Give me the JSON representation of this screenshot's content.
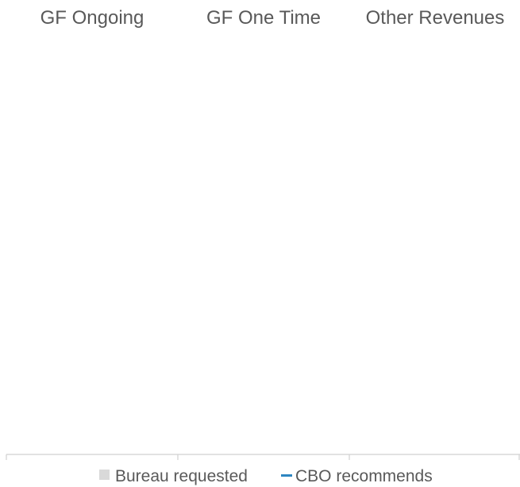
{
  "chart_data": {
    "type": "bar",
    "categories": [
      "GF Ongoing",
      "GF One Time",
      "Other Revenues"
    ],
    "series": [
      {
        "name": "Bureau requested",
        "values": [
          null,
          null,
          null
        ]
      },
      {
        "name": "CBO recommends",
        "values": [
          null,
          null,
          null
        ]
      }
    ],
    "title": "",
    "xlabel": "",
    "ylabel": "",
    "grid": false,
    "legend_position": "bottom",
    "colors": {
      "bureau_requested": "#d9d9d9",
      "cbo_recommends": "#2e86c1",
      "text": "#595959",
      "axis": "#d0d0d0"
    }
  }
}
